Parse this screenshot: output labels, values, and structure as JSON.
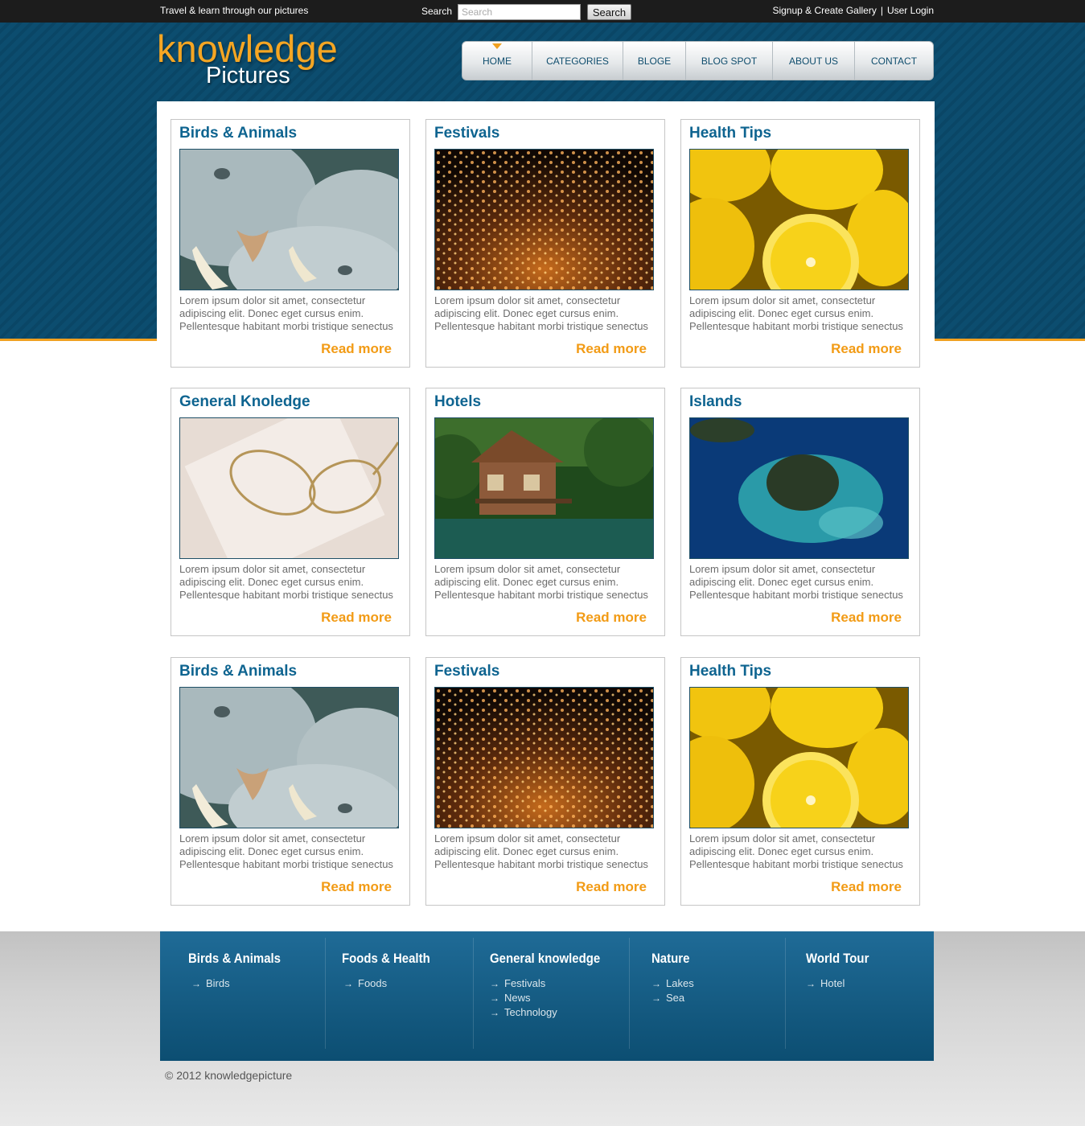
{
  "topbar": {
    "tagline": "Travel & learn through our pictures",
    "search_label": "Search",
    "search_placeholder": "Search",
    "search_button": "Search",
    "signup_link": "Signup & Create Gallery",
    "separator": "|",
    "login_link": "User Login"
  },
  "logo": {
    "line1": "knowledge",
    "line2": "Pictures"
  },
  "nav": [
    "HOME",
    "CATEGORIES",
    "BLOGE",
    "BLOG SPOT",
    "ABOUT US",
    "CONTACT"
  ],
  "cards": [
    {
      "title": "Birds & Animals",
      "image": "elephants",
      "text": "Lorem ipsum dolor sit amet, consectetur adipiscing elit. Donec eget cursus enim. Pellentesque habitant morbi tristique senectus",
      "link": "Read more"
    },
    {
      "title": "Festivals",
      "image": "lanterns",
      "text": "Lorem ipsum dolor sit amet, consectetur adipiscing elit. Donec eget cursus enim. Pellentesque habitant morbi tristique senectus",
      "link": "Read more"
    },
    {
      "title": "Health Tips",
      "image": "lemons",
      "text": "Lorem ipsum dolor sit amet, consectetur adipiscing elit. Donec eget cursus enim. Pellentesque habitant morbi tristique senectus",
      "link": "Read more"
    },
    {
      "title": "General Knoledge",
      "image": "glasses",
      "text": "Lorem ipsum dolor sit amet, consectetur adipiscing elit. Donec eget cursus enim. Pellentesque habitant morbi tristique senectus",
      "link": "Read more"
    },
    {
      "title": "Hotels",
      "image": "lake-house",
      "text": "Lorem ipsum dolor sit amet, consectetur adipiscing elit. Donec eget cursus enim. Pellentesque habitant morbi tristique senectus",
      "link": "Read more"
    },
    {
      "title": "Islands",
      "image": "island",
      "text": "Lorem ipsum dolor sit amet, consectetur adipiscing elit. Donec eget cursus enim. Pellentesque habitant morbi tristique senectus",
      "link": "Read more"
    },
    {
      "title": "Birds & Animals",
      "image": "elephants",
      "text": "Lorem ipsum dolor sit amet, consectetur adipiscing elit. Donec eget cursus enim. Pellentesque habitant morbi tristique senectus",
      "link": "Read more"
    },
    {
      "title": "Festivals",
      "image": "lanterns",
      "text": "Lorem ipsum dolor sit amet, consectetur adipiscing elit. Donec eget cursus enim. Pellentesque habitant morbi tristique senectus",
      "link": "Read more"
    },
    {
      "title": "Health Tips",
      "image": "lemons",
      "text": "Lorem ipsum dolor sit amet, consectetur adipiscing elit. Donec eget cursus enim. Pellentesque habitant morbi tristique senectus",
      "link": "Read more"
    }
  ],
  "footer": {
    "columns": [
      {
        "heading": "Birds & Animals",
        "links": [
          "Birds"
        ]
      },
      {
        "heading": "Foods & Health",
        "links": [
          "Foods"
        ]
      },
      {
        "heading": "General knowledge",
        "links": [
          "Festivals",
          "News",
          "Technology"
        ]
      },
      {
        "heading": "Nature",
        "links": [
          "Lakes",
          "Sea"
        ]
      },
      {
        "heading": "World Tour",
        "links": [
          "Hotel"
        ]
      }
    ]
  },
  "copyright": "© 2012 knowledgepicture",
  "colors": {
    "brand_blue": "#0c4d6f",
    "accent_orange": "#f29b15",
    "title_blue": "#0e6490"
  }
}
